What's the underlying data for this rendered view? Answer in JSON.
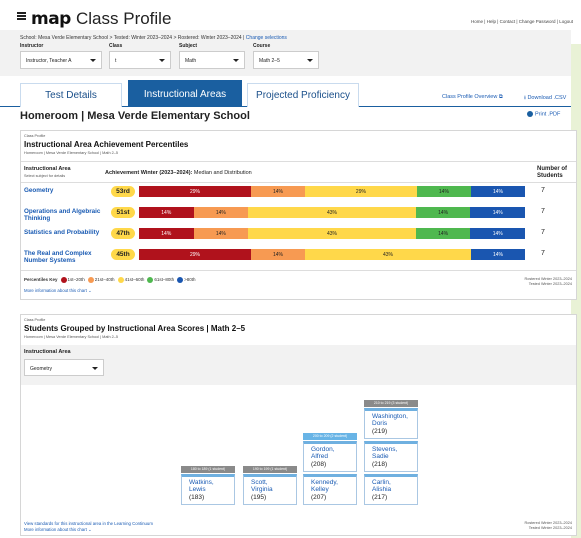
{
  "header": {
    "logo": "map",
    "title": "Class Profile",
    "links": "Home | Help | Contact | Change Password | Logout"
  },
  "breadcrumb": {
    "text": "School: Mesa Verde Elementary School > Tested: Winter 2023–2024 > Rostered: Winter 2023–2024 | ",
    "link": "Change selections"
  },
  "filters": {
    "instructor": {
      "label": "Instructor",
      "value": "Instructor, Teacher A"
    },
    "class": {
      "label": "Class",
      "value": "t"
    },
    "subject": {
      "label": "Subject",
      "value": "Math"
    },
    "course": {
      "label": "Course",
      "value": "Math 2–5"
    }
  },
  "tabs": [
    "Test Details",
    "Instructional Areas",
    "Projected Proficiency"
  ],
  "tab_links": {
    "overview": "Class Profile Overview ⧉",
    "download": "⭳ Download .CSV"
  },
  "heading": "Homeroom | Mesa Verde Elementary School",
  "print_pdf": "Print .PDF",
  "panel1": {
    "eyebrow": "Class Profile",
    "title": "Instructional Area Achievement Percentiles",
    "subtitle": "Homeroom | Mesa Verde Elementary School | Math 2–5",
    "col_area": "Instructional Area",
    "col_area_sub": "Select subject for details",
    "col_ach": "Achievement Winter (2023–2024):",
    "col_ach_rest": " Median and Distribution",
    "col_num": "Number of Students",
    "rows": [
      {
        "area": "Geometry",
        "median": "53rd",
        "segments": [
          {
            "label": "29%",
            "value": 29,
            "color": "#b0121c"
          },
          {
            "label": "14%",
            "value": 14,
            "color": "#f79a52"
          },
          {
            "label": "29%",
            "value": 29,
            "color": "#ffd84a"
          },
          {
            "label": "14%",
            "value": 14,
            "color": "#4fb84f"
          },
          {
            "label": "14%",
            "value": 14,
            "color": "#1a56b0"
          }
        ],
        "students": "7"
      },
      {
        "area": "Operations and Algebraic Thinking",
        "median": "51st",
        "segments": [
          {
            "label": "14%",
            "value": 14,
            "color": "#b0121c"
          },
          {
            "label": "14%",
            "value": 14,
            "color": "#f79a52"
          },
          {
            "label": "43%",
            "value": 43,
            "color": "#ffd84a"
          },
          {
            "label": "14%",
            "value": 14,
            "color": "#4fb84f"
          },
          {
            "label": "14%",
            "value": 14,
            "color": "#1a56b0"
          }
        ],
        "students": "7"
      },
      {
        "area": "Statistics and Probability",
        "median": "47th",
        "segments": [
          {
            "label": "14%",
            "value": 14,
            "color": "#b0121c"
          },
          {
            "label": "14%",
            "value": 14,
            "color": "#f79a52"
          },
          {
            "label": "43%",
            "value": 43,
            "color": "#ffd84a"
          },
          {
            "label": "14%",
            "value": 14,
            "color": "#4fb84f"
          },
          {
            "label": "14%",
            "value": 14,
            "color": "#1a56b0"
          }
        ],
        "students": "7"
      },
      {
        "area": "The Real and Complex Number Systems",
        "median": "45th",
        "segments": [
          {
            "label": "29%",
            "value": 29,
            "color": "#b0121c"
          },
          {
            "label": "14%",
            "value": 14,
            "color": "#f79a52"
          },
          {
            "label": "43%",
            "value": 43,
            "color": "#ffd84a"
          },
          {
            "label": "",
            "value": 0,
            "color": "#4fb84f"
          },
          {
            "label": "14%",
            "value": 14,
            "color": "#1a56b0"
          }
        ],
        "students": "7"
      }
    ],
    "key_label": "Percentiles Key",
    "key": [
      {
        "label": "1st–20th",
        "color": "#b0121c"
      },
      {
        "label": "21st–40th",
        "color": "#f79a52"
      },
      {
        "label": "41st–60th",
        "color": "#ffd84a"
      },
      {
        "label": "61st–80th",
        "color": "#4fb84f"
      },
      {
        "label": ">80th",
        "color": "#1a56b0"
      }
    ],
    "note1": "Rostered Winter 2023–2024",
    "note2": "Tested Winter 2023–2024",
    "more": "More information about this chart ⌄"
  },
  "panel2": {
    "eyebrow": "Class Profile",
    "title": "Students Grouped by Instructional Area Scores | Math 2–5",
    "subtitle": "Homeroom | Mesa Verde Elementary School | Math 2–5",
    "area_label": "Instructional Area",
    "area_value": "Geometry",
    "groups": [
      {
        "range": "180 to 189 (1 student)",
        "blue": false,
        "students": [
          {
            "first": "Watkins,",
            "last": "Lewis",
            "score": "(183)"
          }
        ]
      },
      {
        "range": "190 to 199 (1 student)",
        "blue": false,
        "students": [
          {
            "first": "Scott,",
            "last": "Virginia",
            "score": "(195)"
          }
        ]
      },
      {
        "range": "200 to 209 (2 student)",
        "blue": true,
        "students": [
          {
            "first": "Kennedy,",
            "last": "Kelley",
            "score": "(207)"
          },
          {
            "first": "Gordon,",
            "last": "Alfred",
            "score": "(208)"
          }
        ]
      },
      {
        "range": "210 to 219 (3 student)",
        "blue": false,
        "students": [
          {
            "first": "Carlin,",
            "last": "Alishia",
            "score": "(217)"
          },
          {
            "first": "Stevens,",
            "last": "Sadie",
            "score": "(218)"
          },
          {
            "first": "Washington,",
            "last": "Doris",
            "score": "(219)"
          }
        ]
      }
    ],
    "foot1": "View standards for this instructional area in the Learning Continuum",
    "foot2": "More information about this chart ⌄",
    "note1": "Rostered Winter 2023–2024",
    "note2": "Tested Winter 2023–2024"
  }
}
